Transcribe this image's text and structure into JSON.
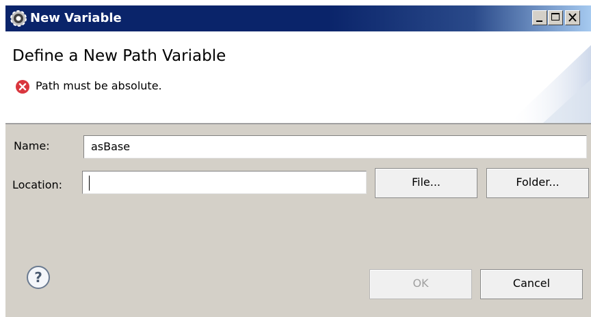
{
  "window": {
    "title": "New Variable",
    "icon": "gear-icon",
    "controls": [
      "minimize-icon",
      "maximize-icon",
      "close-icon"
    ]
  },
  "header": {
    "heading": "Define a New Path Variable",
    "message": "Path must be absolute.",
    "message_icon": "error-icon"
  },
  "form": {
    "name_label": "Name:",
    "name_value": "asBase",
    "location_label": "Location:",
    "location_value": "",
    "file_button": "File...",
    "folder_button": "Folder..."
  },
  "footer": {
    "help_icon": "help-icon",
    "ok_button": "OK",
    "cancel_button": "Cancel"
  },
  "colors": {
    "title_bar": "#0a246a",
    "dialog_bg": "#d4d0c8",
    "error": "#d9363e"
  }
}
